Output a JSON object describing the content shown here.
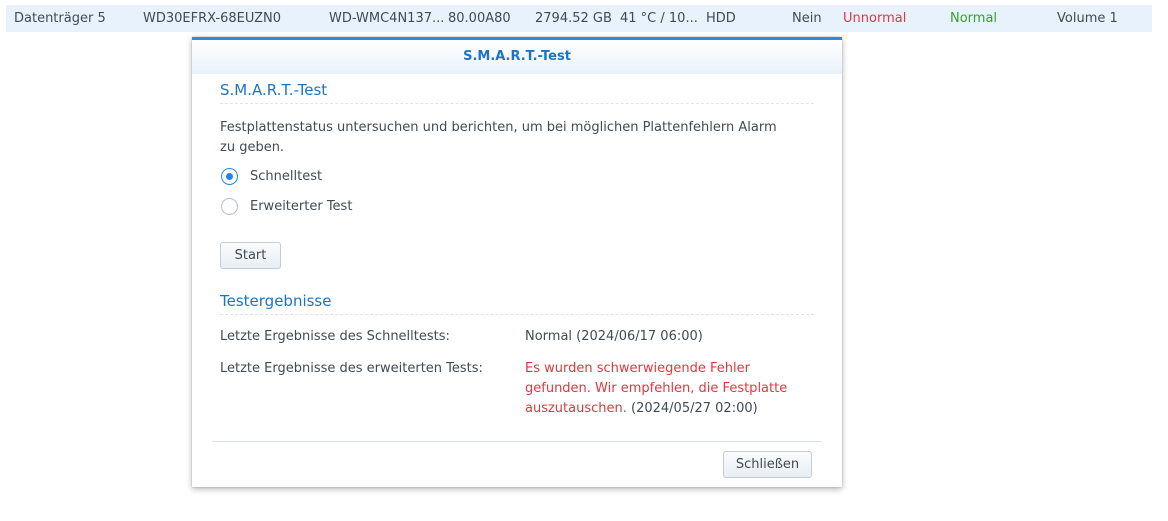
{
  "disk_row": {
    "name": "Datenträger 5",
    "model": "WD30EFRX-68EUZN0",
    "serial": "WD-WMC4N137...",
    "firmware": "80.00A80",
    "size": "2794.52 GB",
    "temperature": "41 °C / 10...",
    "type": "HDD",
    "hot_spare": "Nein",
    "health": "Unnormal",
    "status": "Normal",
    "volume": "Volume 1"
  },
  "colors": {
    "accent": "#1d74c4",
    "row_highlight": "#e8f2fc",
    "error": "#e0383e",
    "ok": "#34a32a"
  },
  "dialog": {
    "title": "S.M.A.R.T.-Test",
    "smart_section": {
      "heading": "S.M.A.R.T.-Test",
      "description": "Festplattenstatus untersuchen und berichten, um bei möglichen Plattenfehlern Alarm zu geben.",
      "options": [
        {
          "label": "Schnelltest",
          "selected": true
        },
        {
          "label": "Erweiterter Test",
          "selected": false
        }
      ],
      "start_label": "Start"
    },
    "results_section": {
      "heading": "Testergebnisse",
      "quick_label": "Letzte Ergebnisse des Schnelltests:",
      "quick_value": "Normal (2024/06/17 06:00)",
      "extended_label": "Letzte Ergebnisse des erweiterten Tests:",
      "extended_value_error": "Es wurden schwerwiegende Fehler gefunden. Wir empfehlen, die Festplatte auszutauschen.",
      "extended_value_date": "(2024/05/27 02:00)"
    },
    "close_label": "Schließen"
  }
}
